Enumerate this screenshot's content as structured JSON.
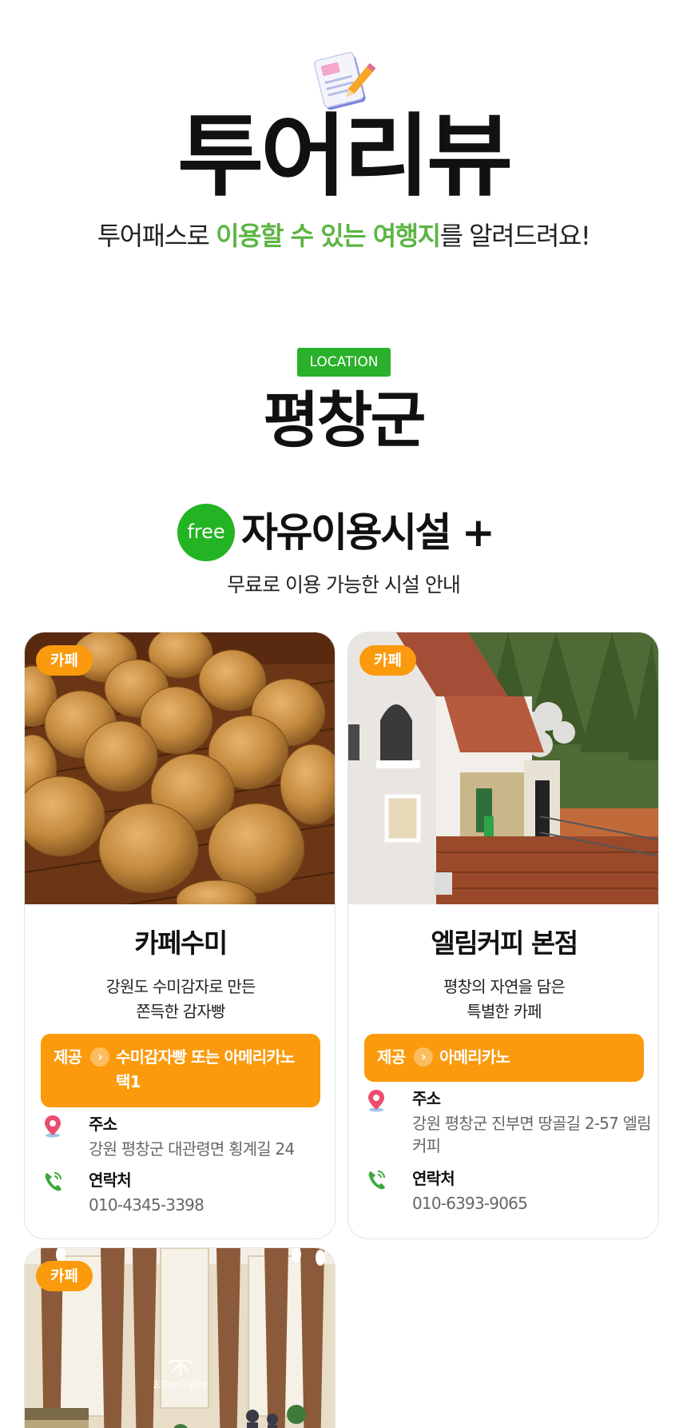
{
  "hero": {
    "title": "투어리뷰",
    "subtitle_pre": "투어패스로 ",
    "subtitle_highlight": "이용할 수 있는 여행지",
    "subtitle_post": "를 알려드려요!",
    "icon": "document-pencil-icon"
  },
  "location": {
    "badge": "LOCATION",
    "name": "평창군"
  },
  "facility": {
    "free_badge": "free",
    "title": "자유이용시설 +",
    "description": "무료로 이용 가능한 시설 안내"
  },
  "colors": {
    "accent_green": "#5cb543",
    "badge_green": "#2bb02b",
    "orange": "#fa9a0c"
  },
  "cards": [
    {
      "category": "카페",
      "name": "카페수미",
      "desc_line1": "강원도 수미감자로 만든",
      "desc_line2": "쫀득한 감자빵",
      "offer_label": "제공",
      "offer_text": "수미감자빵 또는 아메리카노 택1",
      "address_label": "주소",
      "address": "강원 평창군 대관령면 횡계길 24",
      "contact_label": "연락처",
      "phone": "010-4345-3398"
    },
    {
      "category": "카페",
      "name": "엘림커피 본점",
      "desc_line1": "평창의 자연을 담은",
      "desc_line2": "특별한 카페",
      "offer_label": "제공",
      "offer_text": "아메리카노",
      "address_label": "주소",
      "address": "강원 평창군 진부면 땅골길 2-57 엘림커피",
      "contact_label": "연락처",
      "phone": "010-6393-9065"
    },
    {
      "category": "카페",
      "image_text": "ElimCoffee"
    }
  ]
}
